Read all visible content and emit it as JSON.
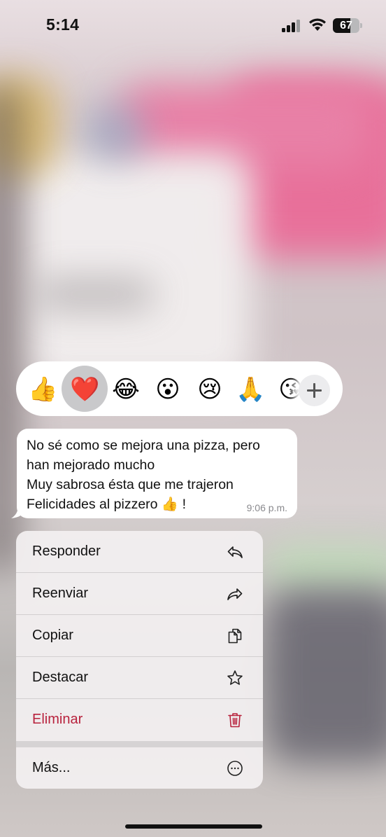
{
  "status_bar": {
    "time": "5:14",
    "battery": "67"
  },
  "reactions": {
    "emojis": [
      "👍",
      "❤️",
      "😂",
      "😮",
      "😢",
      "🙏",
      "😘"
    ],
    "selected": "❤️"
  },
  "message": {
    "lines": [
      "No sé como se mejora una pizza, pero",
      "han mejorado mucho",
      "Muy sabrosa ésta que me trajeron",
      "Felicidades al pizzero 👍 !"
    ],
    "time": "9:06 p.m."
  },
  "menu": {
    "reply": "Responder",
    "forward": "Reenviar",
    "copy": "Copiar",
    "star": "Destacar",
    "delete": "Eliminar",
    "more": "Más..."
  },
  "colors": {
    "danger": "#b8223d",
    "bubble": "#ffffff"
  }
}
